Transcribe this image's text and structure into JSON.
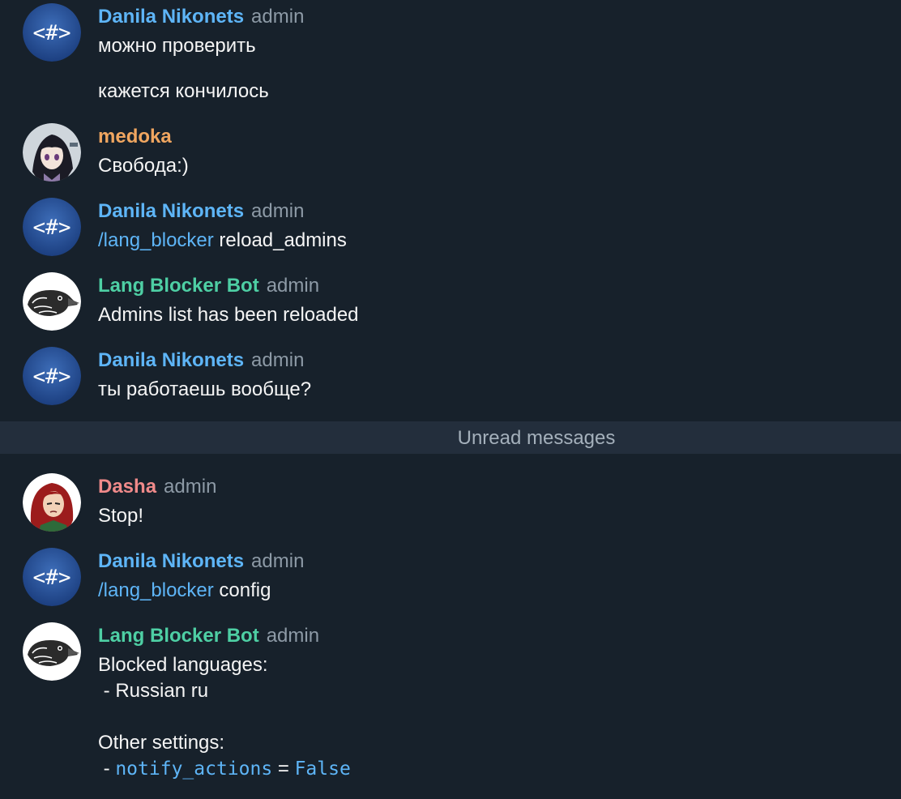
{
  "colors": {
    "background": "#17212b",
    "danila": "#5eb5f7",
    "medoka": "#f0a660",
    "bot": "#4ecfa4",
    "dasha": "#f08a8a",
    "role": "#8d9aa6",
    "command": "#5eb5f7",
    "unread_bar": "#232e3c"
  },
  "messages": [
    {
      "author": "Danila Nikonets",
      "role": "admin",
      "lines": [
        "можно проверить"
      ],
      "followup": "кажется кончилось",
      "avatar": "hash-code-avatar"
    },
    {
      "author": "medoka",
      "role": "",
      "lines": [
        "Свобода:)"
      ],
      "avatar": "anime-girl-avatar"
    },
    {
      "author": "Danila Nikonets",
      "role": "admin",
      "command": "/lang_blocker",
      "rest": " reload_admins",
      "avatar": "hash-code-avatar"
    },
    {
      "author": "Lang Blocker Bot",
      "role": "admin",
      "lines": [
        "Admins list has been reloaded"
      ],
      "avatar": "bird-avatar"
    },
    {
      "author": "Danila Nikonets",
      "role": "admin",
      "lines": [
        "ты работаешь вообще?"
      ],
      "avatar": "hash-code-avatar"
    },
    {
      "author": "Dasha",
      "role": "admin",
      "lines": [
        "Stop!"
      ],
      "avatar": "red-hair-girl-avatar"
    },
    {
      "author": "Danila Nikonets",
      "role": "admin",
      "command": "/lang_blocker",
      "rest": " config",
      "avatar": "hash-code-avatar"
    },
    {
      "author": "Lang Blocker Bot",
      "role": "admin",
      "lines": [
        "Blocked languages:",
        " - Russian ru",
        "Other settings:",
        " - "
      ],
      "setting_key": "notify_actions",
      "setting_eq": " = ",
      "setting_value": "False",
      "avatar": "bird-avatar"
    }
  ],
  "unread": {
    "label": "Unread messages"
  },
  "avatar_text": {
    "hash": "<#>"
  }
}
